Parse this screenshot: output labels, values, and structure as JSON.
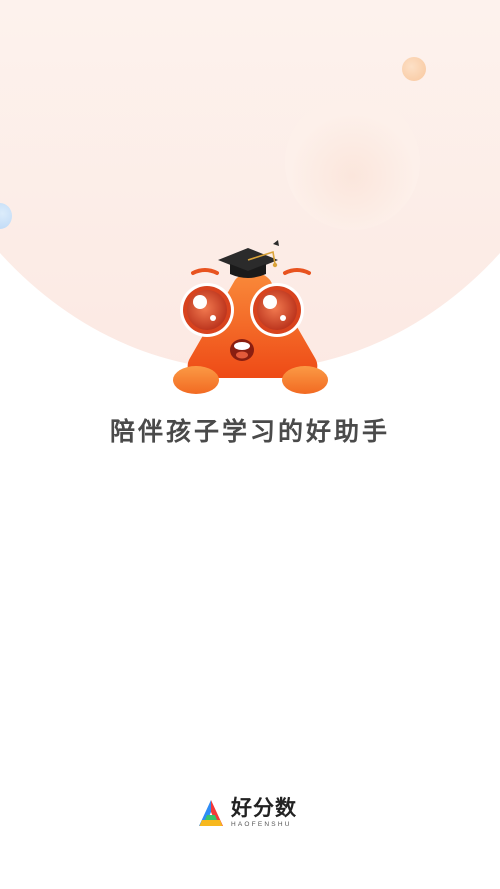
{
  "splash": {
    "slogan": "陪伴孩子学习的好助手",
    "mascot_icon": "graduate-mascot-icon"
  },
  "brand": {
    "name": "好分数",
    "subtitle": "HAOFENSHU",
    "logo_icon": "haofenshu-logo-icon"
  },
  "colors": {
    "mascot_orange": "#f2561d",
    "accent_peach": "#f8c79e",
    "accent_blue": "#b9d6f5",
    "background_tint": "#fce9e3",
    "text_dark": "#4a4a4a"
  }
}
